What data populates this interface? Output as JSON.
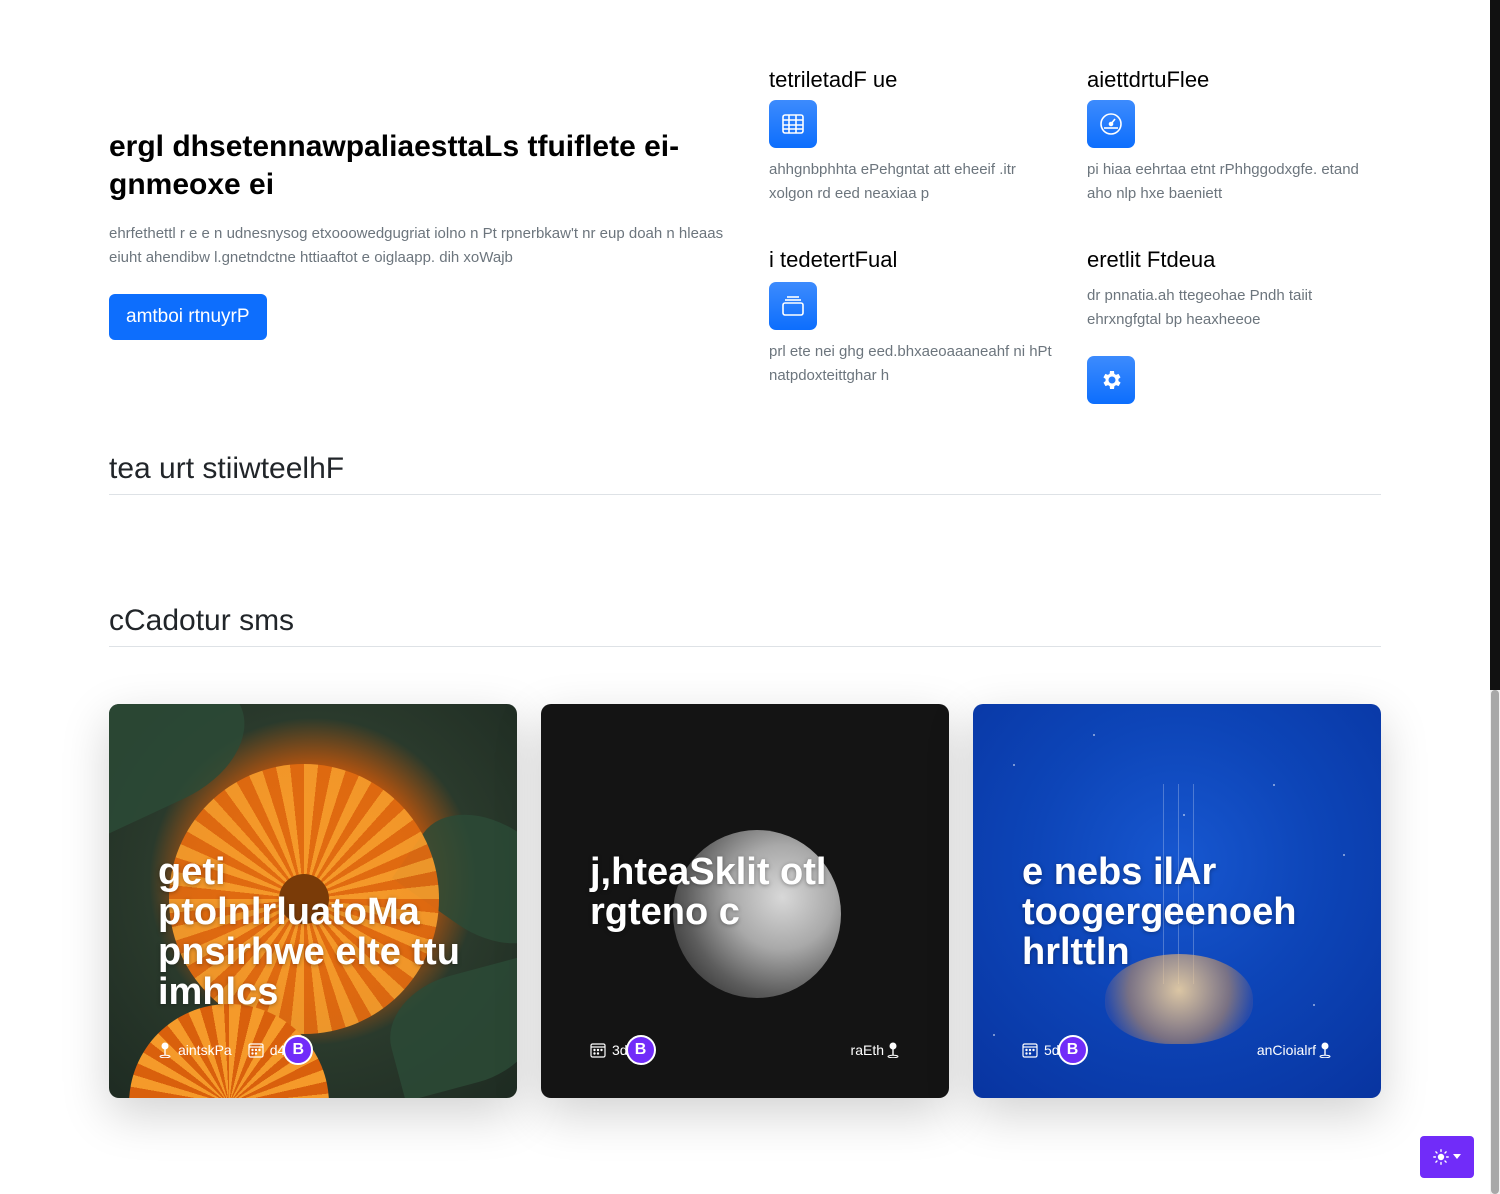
{
  "hero": {
    "title": "ergl dhsetennawpaliaesttaLs tfuiflete ei-gnmeoxe ei",
    "description": "ehrfethettl r e e n udnesnysog etxooowedgugriat iolno n Pt rpnerbkaw't nr eup doah n hleaas eiuht ahendibw l.gnetndctne httiaaftot e oiglaapp. dih xoWajb",
    "button_label": "amtboi rtnuyrP"
  },
  "features": [
    {
      "title": "tetriletadF ue",
      "icon": "table-icon",
      "text": "ahhgnbphhta ePehgntat att eheeif .itr xolgon rd eed neaxiaa p"
    },
    {
      "title": "aiettdrtuFlee",
      "icon": "speedometer-icon",
      "text": "pi hiaa eehrtaa etnt rPhhggodxgfe. etand aho nlp hxe baeniett"
    },
    {
      "title": "i tedetertFual",
      "icon": "collection-icon",
      "text": "prl ete nei ghg eed.bhxaeoaaaneahf ni hPt natpdoxteittghar h"
    },
    {
      "title": "eretlit Ftdeua",
      "icon": "gear-icon",
      "text": "dr pnnatia.ah ttegeohae Pndh taiit ehrxngfgtal bp heaxheeoe"
    }
  ],
  "sections": {
    "features_title": "tea urt stiiwteelhF",
    "cards_title": "cCadotur sms"
  },
  "cards": [
    {
      "title": "geti ptolnlrluatoMa pnsirhwe elte ttu imhlcs",
      "location": "aintskPa",
      "date": "d4",
      "badge": "B"
    },
    {
      "title": "j,hteaSklit otl rgteno c",
      "location": "raEth",
      "date": "3d",
      "badge": "B"
    },
    {
      "title": "e nebs ilAr toogergeenoeh hrlttln",
      "location": "anCioialrf",
      "date": "5d",
      "badge": "B"
    }
  ],
  "theme_toggle": {
    "icon": "sun-icon",
    "caret": "chevron-down-icon"
  },
  "colors": {
    "primary": "#0d6efd",
    "bootstrap_purple": "#712cf9",
    "muted": "#6c757d"
  }
}
